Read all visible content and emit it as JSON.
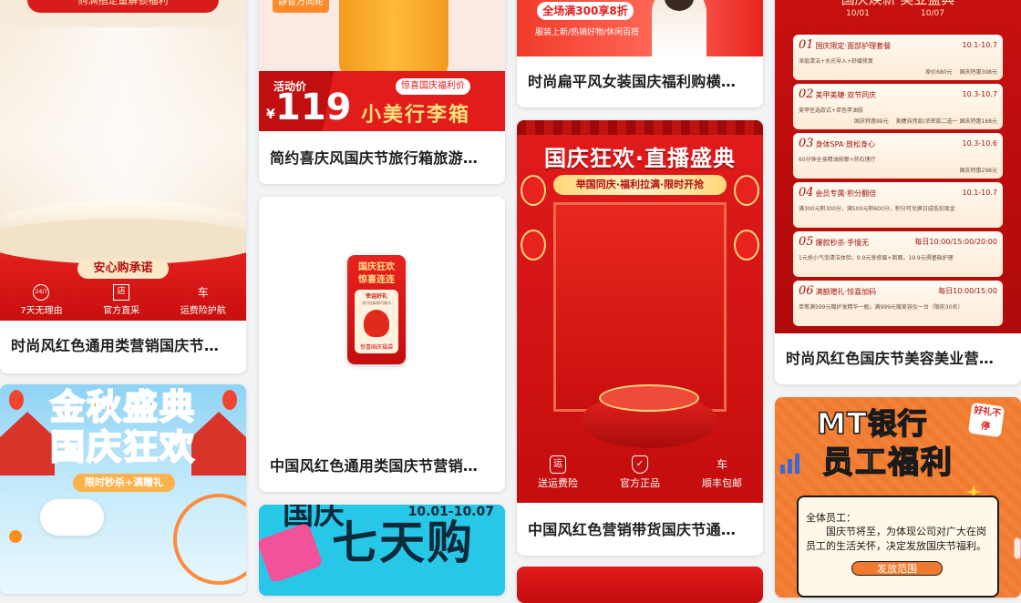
{
  "cards": {
    "c1": {
      "title": "时尚风红色通用类营销国庆节…",
      "top_text": "购满指定量解锁福利",
      "promise": "安心购承诺",
      "features": [
        {
          "icon": "24/7",
          "label": "7天无理由"
        },
        {
          "icon": "店",
          "label": "官方直采"
        },
        {
          "icon": "车",
          "label": "运费险护航"
        }
      ]
    },
    "c2": {
      "title": "金秋盛典国庆狂欢",
      "headline1": "金秋盛典",
      "headline2": "国庆狂欢",
      "sub": "限时秒杀+满赠礼"
    },
    "c3": {
      "title": "简约喜庆风国庆节旅行箱旅游…",
      "tag": "静音万向轮",
      "price_label": "活动价",
      "currency": "¥",
      "price": "119",
      "product": "小美行李箱",
      "benefit": "惊喜国庆福利价"
    },
    "c4": {
      "title": "中国风红色通用类国庆节营销…",
      "badge_top": "国庆狂欢",
      "badge_sub": "惊喜连连",
      "gift": "幸运好礼",
      "gift_note": "实付达标即可参与",
      "footer": "惊喜国庆福袋"
    },
    "c5": {
      "date": "10.01-10.07",
      "headline": "七天购"
    },
    "c6": {
      "title": "时尚扁平风女装国庆福利购横…",
      "promo": "全场满300享8折",
      "sub": "服装上新/热销好物/休闲百搭"
    },
    "c7": {
      "title": "中国风红色营销带货国庆节通…",
      "headline": "国庆狂欢·直播盛典",
      "sub": "举国同庆·福利拉满·限时开抢",
      "features": [
        {
          "icon": "运",
          "label": "送运费险"
        },
        {
          "icon": "✓",
          "label": "官方正品"
        },
        {
          "icon": "车",
          "label": "顺丰包邮"
        }
      ]
    },
    "c8": {
      "title": "时尚风红色国庆节美容美业营…",
      "header": "国庆焕新·美业盛典",
      "date_start": "10/01",
      "date_end": "10/07",
      "items": [
        {
          "num": "01",
          "name": "国庆限定·面部护理套餐",
          "time": "10.1-10.7",
          "desc": "深层清洁+水光导入+舒缓修复",
          "orig": "原价680元",
          "deal": "国庆特惠398元"
        },
        {
          "num": "02",
          "name": "美甲美睫·双节同庆",
          "time": "10.3-10.7",
          "desc": "美甲任选款式+单色甲油胶",
          "orig": "国庆特惠99元",
          "deal": "美睫自然款/浓密款二选一 国庆特惠168元"
        },
        {
          "num": "03",
          "name": "身体SPA·放松身心",
          "time": "10.3-10.6",
          "desc": "60分钟全身精油按摩+热石理疗",
          "orig": "",
          "deal": "国庆特惠298元"
        },
        {
          "num": "04",
          "name": "会员专属·积分翻倍",
          "time": "10.1-10.7",
          "desc": "满300元积300分，满500元积600分，积分可兑换日成低扣现金",
          "orig": "",
          "deal": ""
        },
        {
          "num": "05",
          "name": "爆款秒杀·手慢无",
          "time": "每日10:00/15:00/20:00",
          "desc": "1元抢小气泡清洁体验，9.9元享修眉+剃面，19.9元得基础护理",
          "orig": "",
          "deal": ""
        },
        {
          "num": "06",
          "name": "满额赠礼·惊喜加码",
          "time": "每日10:00/15:00",
          "desc": "单笔满599元赠护发精华一瓶；满999元赠美容仪一台（限前30名）",
          "orig": "",
          "deal": ""
        }
      ]
    },
    "c9": {
      "headline1": "MT银行",
      "headline2": "员工福利",
      "badge": "好礼不停",
      "greeting": "全体员工：",
      "body": "国庆节将至，为体现公司对广大在岗员工的生活关怀，决定发放国庆节福利。",
      "section": "发放范围"
    }
  },
  "colors": {
    "brand_red": "#e21b1b",
    "dark_red": "#b80a0a",
    "gold": "#ffd77a",
    "cyan": "#27c7e8",
    "orange": "#f07a2d"
  }
}
